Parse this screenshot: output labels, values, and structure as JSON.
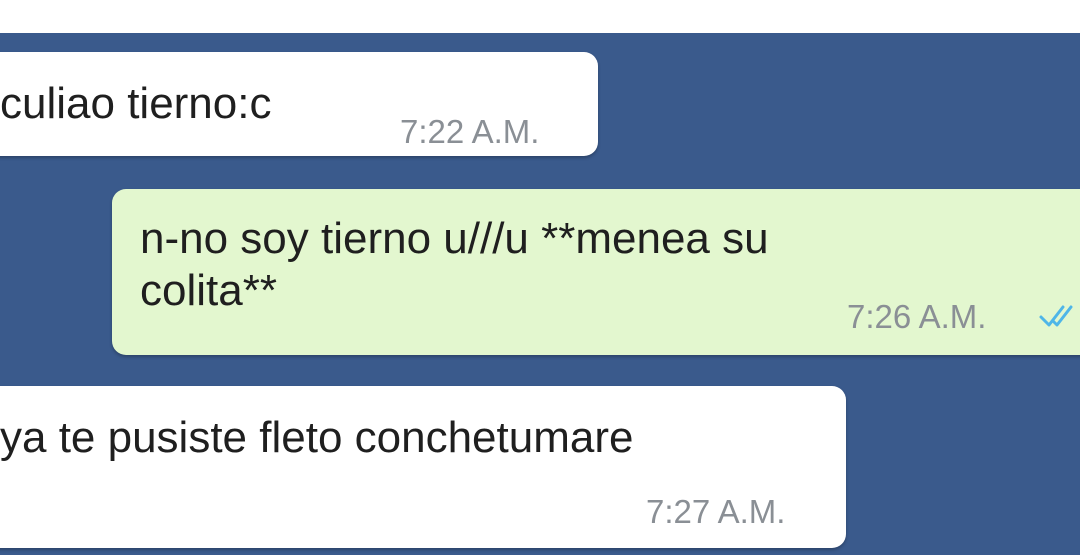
{
  "messages": [
    {
      "direction": "incoming",
      "text": "culiao tierno:c",
      "time": "7:22 A.M."
    },
    {
      "direction": "outgoing",
      "text": "n-no soy tierno u///u **menea su\ncolita**",
      "time": "7:26 A.M.",
      "status_icon": "double-check-read-icon"
    },
    {
      "direction": "incoming",
      "text": "ya te pusiste fleto conchetumare",
      "time": "7:27 A.M."
    }
  ],
  "colors": {
    "chat_background": "#3a5a8c",
    "incoming_bubble": "#ffffff",
    "outgoing_bubble": "#e3f7cf",
    "read_tick": "#4fb6e8"
  }
}
